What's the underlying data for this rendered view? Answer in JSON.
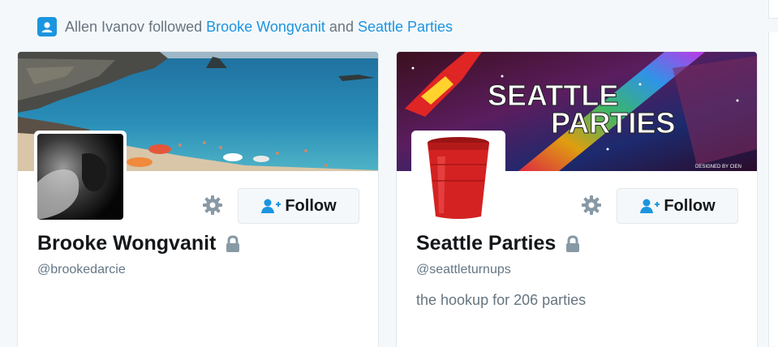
{
  "activity": {
    "actor": "Allen Ivanov",
    "verb": "followed",
    "target1": "Brooke Wongvanit",
    "conjunction": "and",
    "target2": "Seattle Parties",
    "icon": "user-card-icon",
    "accent": "#1b95e0"
  },
  "cards": [
    {
      "fullname": "Brooke Wongvanit",
      "screenname": "@brookedarcie",
      "bio": "",
      "follow_label": "Follow",
      "protected": true
    },
    {
      "fullname": "Seattle Parties",
      "screenname": "@seattleturnups",
      "bio": "the hookup for 206 parties",
      "follow_label": "Follow",
      "protected": true,
      "banner_title_line1": "SEATTLE",
      "banner_title_line2": "PARTIES",
      "banner_credit": "DESIGNED BY CIEN"
    }
  ],
  "colors": {
    "link": "#1b95e0",
    "text": "#14171a",
    "muted": "#657786",
    "icon": "#8899a6"
  }
}
